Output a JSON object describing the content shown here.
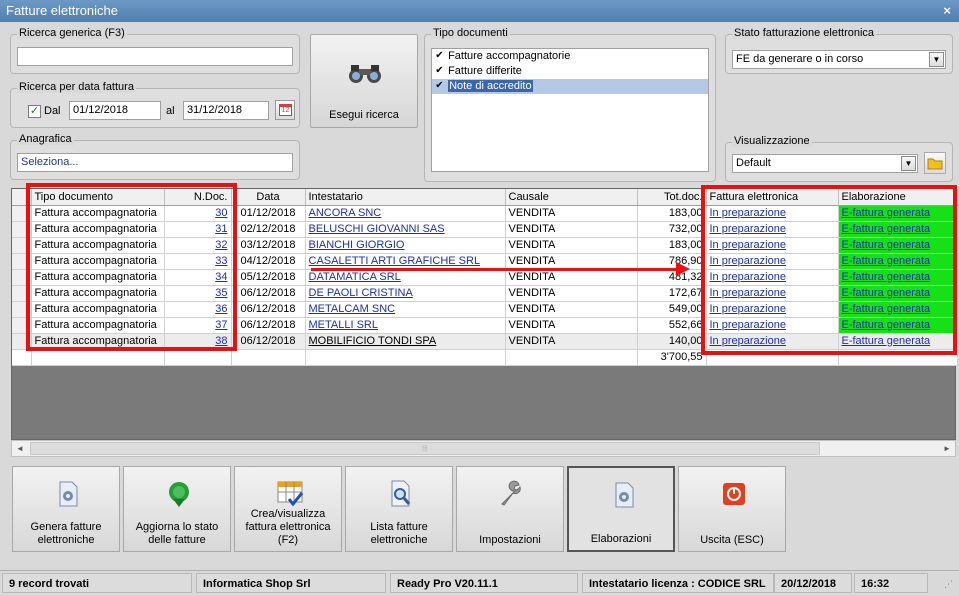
{
  "window": {
    "title": "Fatture elettroniche",
    "close": "×"
  },
  "search": {
    "generic_label": "Ricerca generica (F3)",
    "generic_value": "",
    "date_group_label": "Ricerca per data fattura",
    "dal_label": "Dal",
    "dal_checked": true,
    "date_from": "01/12/2018",
    "al_label": "al",
    "date_to": "31/12/2018",
    "calendar_day": "12",
    "anagrafica_label": "Anagrafica",
    "anagrafica_value": "Seleziona...",
    "search_button": "Esegui ricerca"
  },
  "doc_types": {
    "label": "Tipo documenti",
    "items": [
      {
        "label": "Fatture accompagnatorie",
        "checked": true
      },
      {
        "label": "Fatture differite",
        "checked": true
      },
      {
        "label": "Note di accredito",
        "checked": true
      }
    ]
  },
  "fe_status": {
    "label": "Stato fatturazione elettronica",
    "value": "FE da generare o in corso"
  },
  "view": {
    "label": "Visualizzazione",
    "value": "Default"
  },
  "grid": {
    "headers": [
      "Tipo documento",
      "N.Doc.",
      "Data",
      "Intestatario",
      "Causale",
      "Tot.doc.",
      "Fattura elettronica",
      "Elaborazione"
    ],
    "rows": [
      [
        "Fattura accompagnatoria",
        "30",
        "01/12/2018",
        "ANCORA SNC",
        "VENDITA",
        "183,00",
        "In preparazione",
        "E-fattura generata"
      ],
      [
        "Fattura accompagnatoria",
        "31",
        "02/12/2018",
        "BELUSCHI GIOVANNI SAS",
        "VENDITA",
        "732,00",
        "In preparazione",
        "E-fattura generata"
      ],
      [
        "Fattura accompagnatoria",
        "32",
        "03/12/2018",
        "BIANCHI GIORGIO",
        "VENDITA",
        "183,00",
        "In preparazione",
        "E-fattura generata"
      ],
      [
        "Fattura accompagnatoria",
        "33",
        "04/12/2018",
        "CASALETTI ARTI GRAFICHE SRL",
        "VENDITA",
        "786,90",
        "In preparazione",
        "E-fattura generata"
      ],
      [
        "Fattura accompagnatoria",
        "34",
        "05/12/2018",
        "DATAMATICA SRL",
        "VENDITA",
        "481,32",
        "In preparazione",
        "E-fattura generata"
      ],
      [
        "Fattura accompagnatoria",
        "35",
        "06/12/2018",
        "DE PAOLI CRISTINA",
        "VENDITA",
        "172,67",
        "In preparazione",
        "E-fattura generata"
      ],
      [
        "Fattura accompagnatoria",
        "36",
        "06/12/2018",
        "METALCAM SNC",
        "VENDITA",
        "549,00",
        "In preparazione",
        "E-fattura generata"
      ],
      [
        "Fattura accompagnatoria",
        "37",
        "06/12/2018",
        "METALLI SRL",
        "VENDITA",
        "552,66",
        "In preparazione",
        "E-fattura generata"
      ],
      [
        "Fattura accompagnatoria",
        "38",
        "06/12/2018",
        "MOBILIFICIO TONDI SPA",
        "VENDITA",
        "140,00",
        "In preparazione",
        "E-fattura generata"
      ]
    ],
    "total": "3'700,55"
  },
  "toolbar": [
    {
      "label": "Genera fatture elettroniche",
      "icon": "gear-document-icon"
    },
    {
      "label": "Aggiorna lo stato delle fatture",
      "icon": "refresh-globe-icon"
    },
    {
      "label": "Crea/visualizza fattura elettronica (F2)",
      "icon": "grid-check-icon"
    },
    {
      "label": "Lista fatture elettroniche",
      "icon": "document-search-icon"
    },
    {
      "label": "Impostazioni",
      "icon": "wrench-icon"
    },
    {
      "label": "Elaborazioni",
      "icon": "gear-document-icon"
    },
    {
      "label": "Uscita (ESC)",
      "icon": "power-icon"
    }
  ],
  "status": {
    "records": "9 record trovati",
    "company": "Informatica Shop Srl",
    "version": "Ready Pro V20.11.1",
    "licensee": "Intestatario licenza : CODICE SRL",
    "date": "20/12/2018",
    "time": "16:32"
  },
  "colors": {
    "title_bar": "#5a88b8",
    "highlight": "#e81010",
    "status_green": "#16e016",
    "link": "#1a2fb0"
  }
}
